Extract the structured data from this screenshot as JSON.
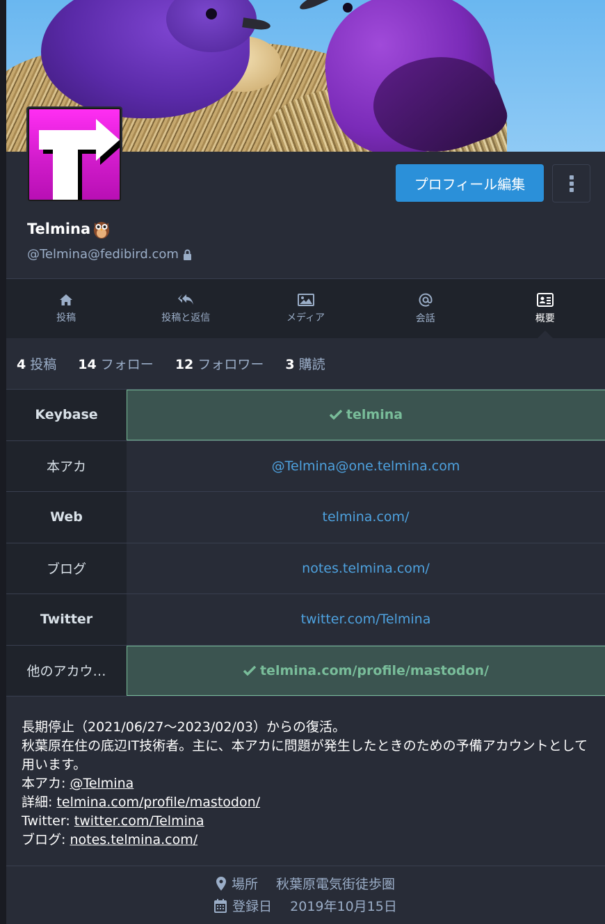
{
  "profile": {
    "display_name": "Telmina",
    "acct": "@Telmina@fedibird.com",
    "edit_button": "プロフィール編集"
  },
  "tabs": [
    {
      "label": "投稿",
      "icon": "home-icon"
    },
    {
      "label": "投稿と返信",
      "icon": "reply-all-icon"
    },
    {
      "label": "メディア",
      "icon": "picture-icon"
    },
    {
      "label": "会話",
      "icon": "at-icon"
    },
    {
      "label": "概要",
      "icon": "id-card-icon",
      "active": true
    }
  ],
  "counts": [
    {
      "num": "4",
      "label": "投稿"
    },
    {
      "num": "14",
      "label": "フォロー"
    },
    {
      "num": "12",
      "label": "フォロワー"
    },
    {
      "num": "3",
      "label": "購読"
    }
  ],
  "fields": [
    {
      "name": "Keybase",
      "value": "telmina",
      "verified": true,
      "bold_name": true
    },
    {
      "name": "本アカ",
      "value": "@Telmina@one.telmina.com",
      "verified": false,
      "bold_name": false
    },
    {
      "name": "Web",
      "value": "telmina.com/",
      "verified": false,
      "bold_name": true
    },
    {
      "name": "ブログ",
      "value": "notes.telmina.com/",
      "verified": false,
      "bold_name": false
    },
    {
      "name": "Twitter",
      "value": "twitter.com/Telmina",
      "verified": false,
      "bold_name": true
    },
    {
      "name": "他のアカウ…",
      "value": "telmina.com/profile/mastodon/",
      "verified": true,
      "bold_name": false
    }
  ],
  "bio": {
    "line1": "長期停止（2021/06/27～2023/02/03）からの復活。",
    "line2": "秋葉原在住の底辺IT技術者。主に、本アカに問題が発生したときのための予備アカウントとして用います。",
    "links": [
      {
        "prefix": "本アカ: ",
        "text": "@Telmina"
      },
      {
        "prefix": "詳細: ",
        "text": "telmina.com/profile/mastodon/"
      },
      {
        "prefix": "Twitter: ",
        "text": "twitter.com/Telmina"
      },
      {
        "prefix": "ブログ: ",
        "text": "notes.telmina.com/"
      }
    ]
  },
  "meta": {
    "location_label": "場所",
    "location_value": "秋葉原電気街徒歩圏",
    "joined_label": "登録日",
    "joined_value": "2019年10月15日"
  },
  "colors": {
    "accent": "#2b90d9",
    "link": "#4ea2df",
    "verified_bg": "#3b5450",
    "verified_text": "#79bd9a",
    "panel_bg": "#282c37"
  }
}
